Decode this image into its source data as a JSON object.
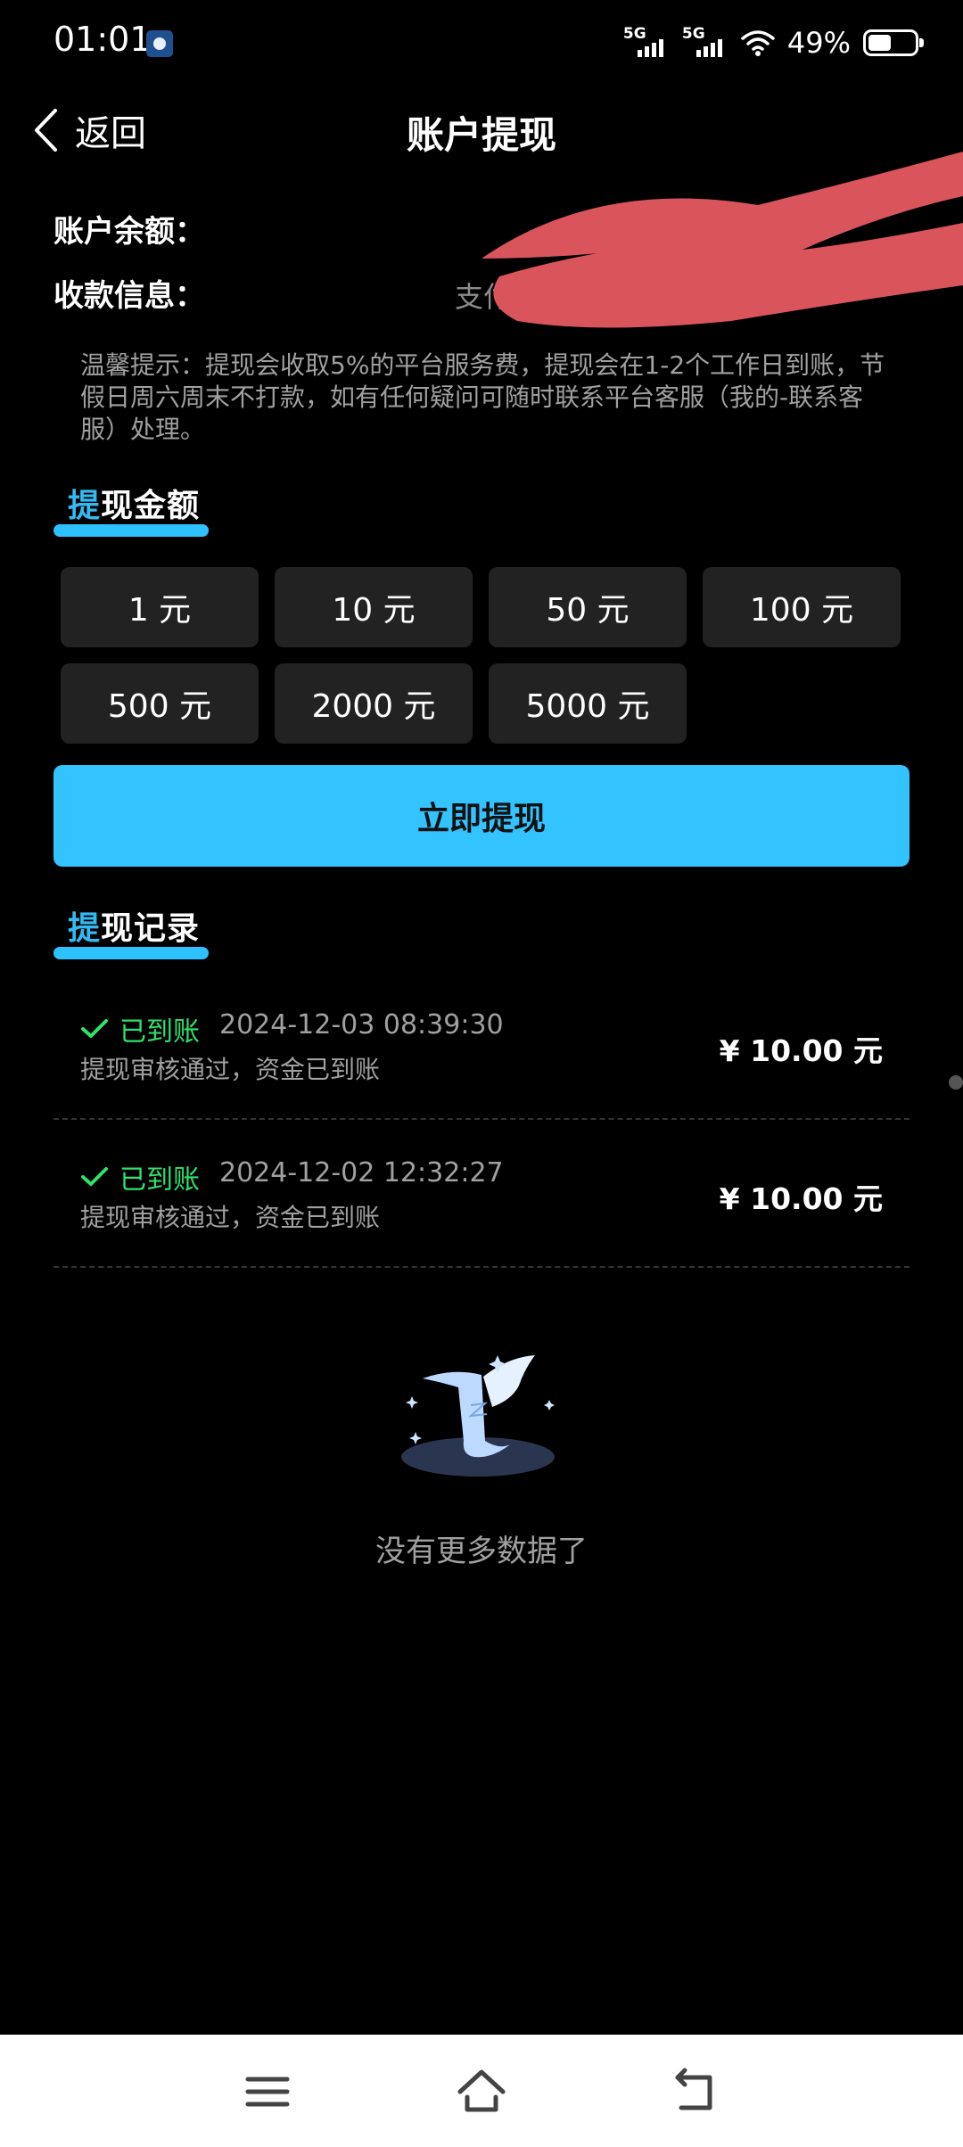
{
  "status_bar": {
    "time": "01:01",
    "signal_1": "5G",
    "signal_2": "5G",
    "battery_percent": "49%",
    "battery_level": 0.49
  },
  "header": {
    "back_label": "返回",
    "title": "账户提现"
  },
  "account": {
    "balance_label": "账户余额：",
    "payment_label": "收款信息：",
    "payment_value": "支付宝"
  },
  "tip": "温馨提示：提现会收取5%的平台服务费，提现会在1-2个工作日到账，节假日周六周末不打款，如有任何疑问可随时联系平台客服（我的-联系客服）处理。",
  "amount_section": {
    "title_first": "提",
    "title_rest": "现金额"
  },
  "amounts": [
    {
      "label": "1 元"
    },
    {
      "label": "10 元"
    },
    {
      "label": "50 元"
    },
    {
      "label": "100 元"
    },
    {
      "label": "500 元"
    },
    {
      "label": "2000 元"
    },
    {
      "label": "5000 元"
    }
  ],
  "withdraw_button": "立即提现",
  "record_section": {
    "title_first": "提",
    "title_rest": "现记录"
  },
  "records": [
    {
      "status": "已到账",
      "time": "2024-12-03 08:39:30",
      "desc": "提现审核通过，资金已到账",
      "amount": "¥ 10.00 元"
    },
    {
      "status": "已到账",
      "time": "2024-12-02 12:32:27",
      "desc": "提现审核通过，资金已到账",
      "amount": "¥ 10.00 元"
    }
  ],
  "empty_text": "没有更多数据了",
  "colors": {
    "accent": "#33c3ff",
    "success": "#2ee26b",
    "redaction": "#d9555b"
  }
}
